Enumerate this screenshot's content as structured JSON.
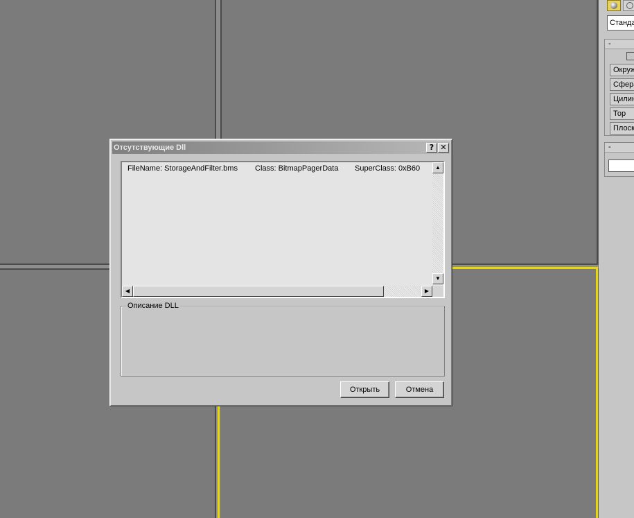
{
  "dialog": {
    "title": "Отсутствующие Dll",
    "help_label": "?",
    "close_label": "✕",
    "list": {
      "rows": [
        {
          "filename": "FileName:  StorageAndFilter.bms",
          "class": "Class:  BitmapPagerData",
          "superclass": "SuperClass: 0xB60"
        }
      ]
    },
    "group_label": "Описание DLL",
    "open_label": "Открыть",
    "cancel_label": "Отмена"
  },
  "command_panel": {
    "combo_value": "Стандарт",
    "rollout1_header": "-",
    "rollout2_header": "-",
    "buttons": [
      "Окружн",
      "Сфера",
      "Цилиндр",
      "Тор",
      "Плоскость"
    ]
  },
  "colors": {
    "active_viewport_border": "#e8d800",
    "dialog_bg": "#c6c6c6",
    "viewport_bg": "#7b7b7b"
  }
}
